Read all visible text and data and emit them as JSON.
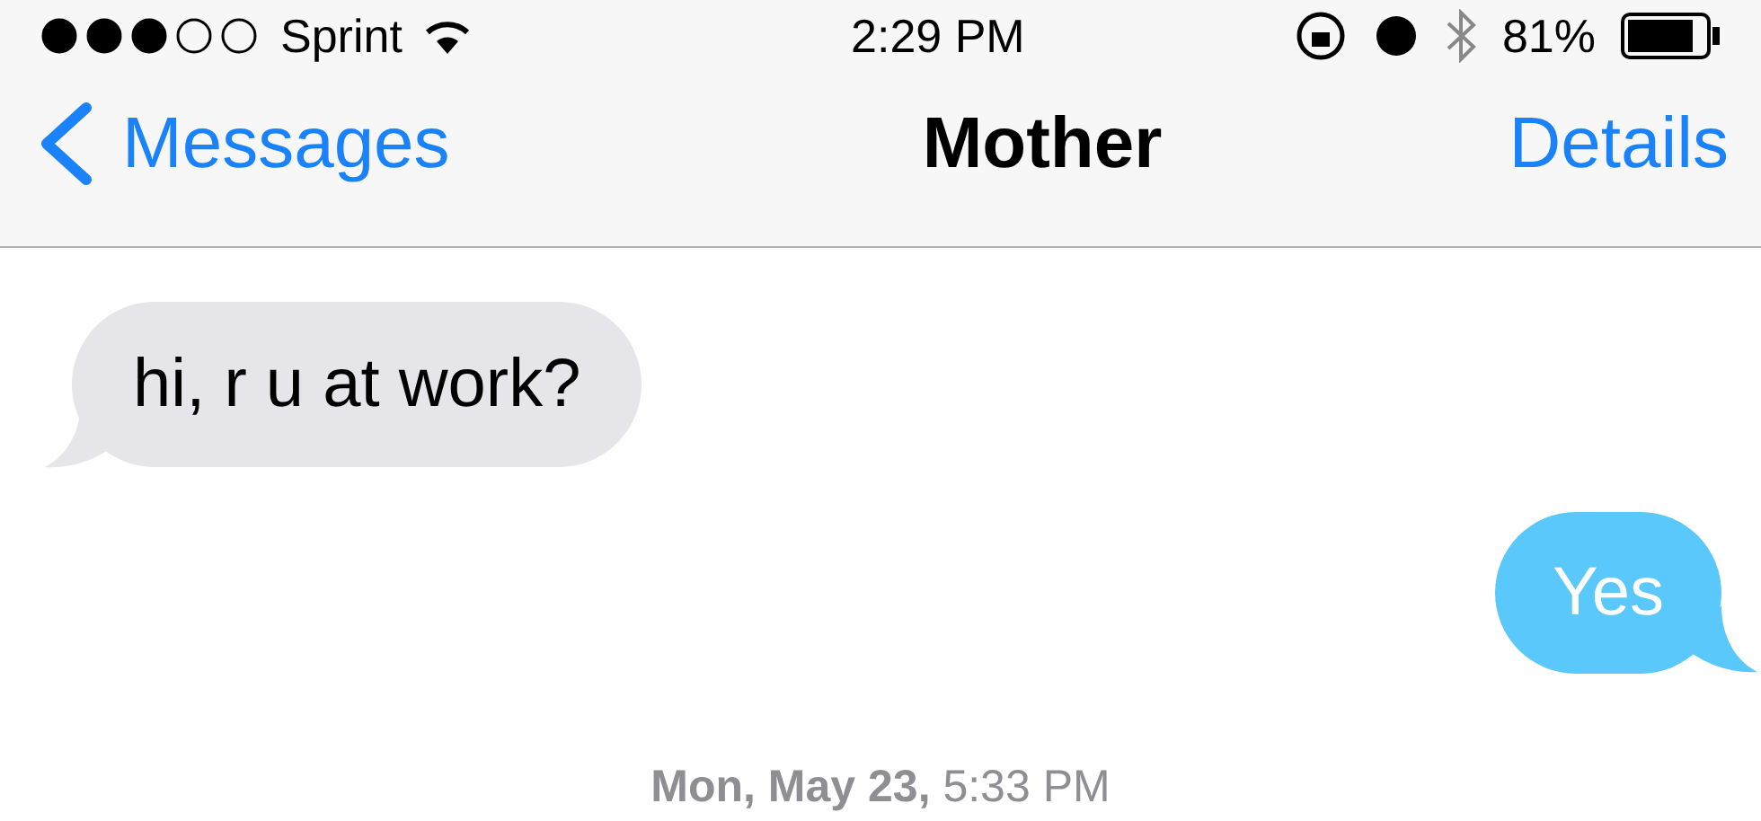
{
  "status_bar": {
    "carrier": "Sprint",
    "time": "2:29 PM",
    "battery": "81%"
  },
  "nav_bar": {
    "back": "Messages",
    "title": "Mother",
    "action": "Details"
  },
  "messages": [
    {
      "kind": "incoming",
      "text": "hi, r u at work?"
    },
    {
      "kind": "outgoing",
      "text": "Yes"
    }
  ],
  "timestamp": "**Mon, May 23,** 5:33 PM"
}
